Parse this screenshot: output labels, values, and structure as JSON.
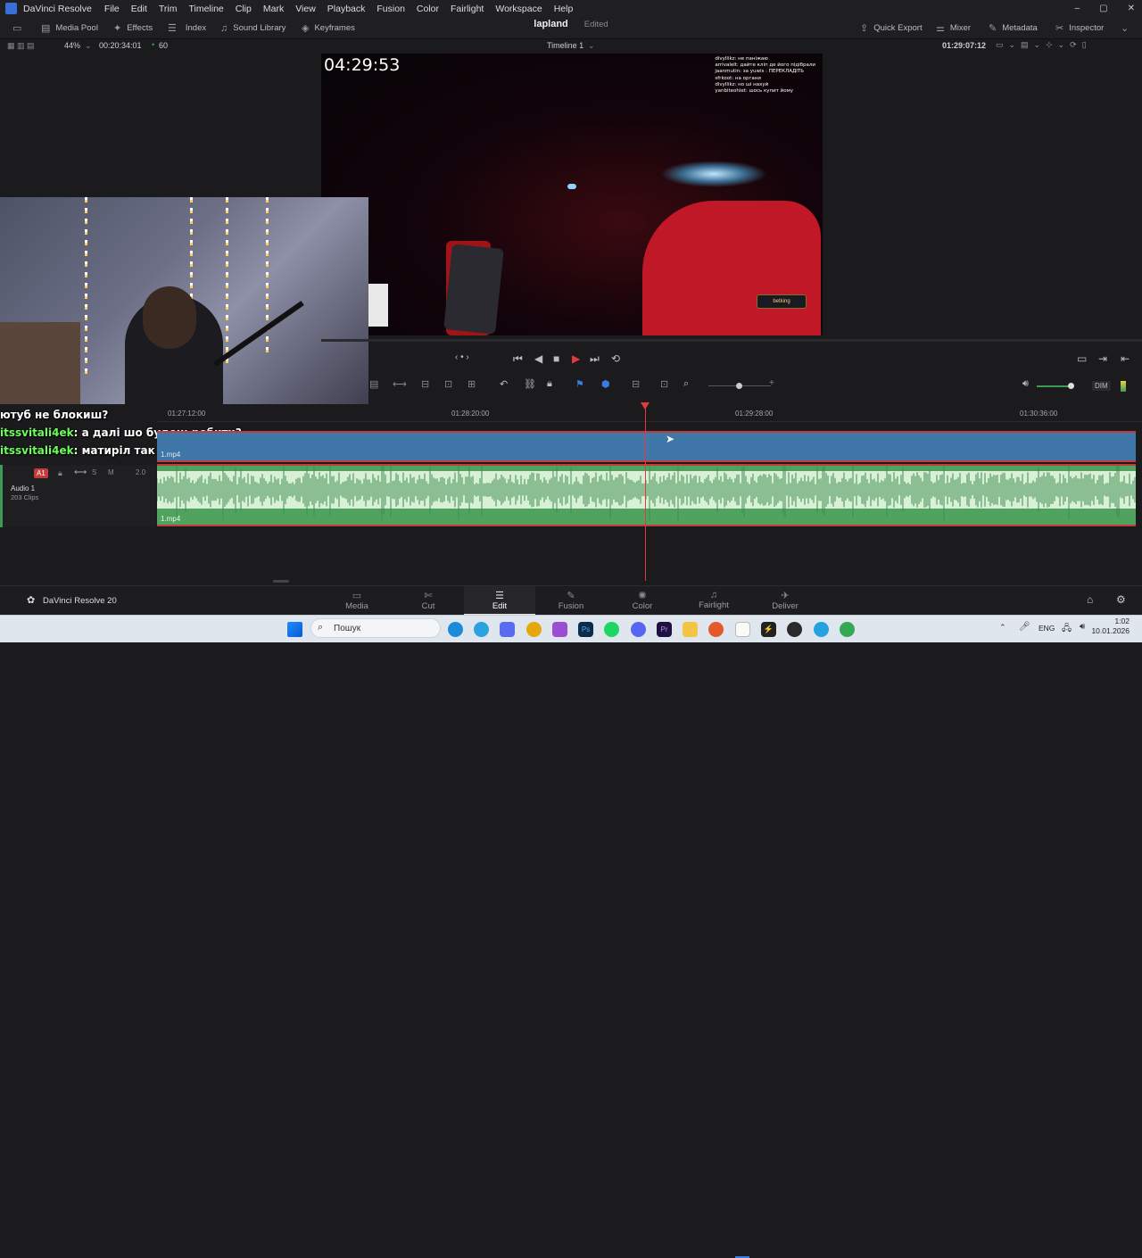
{
  "titlebar": {
    "app": "DaVinci Resolve",
    "menu": [
      "File",
      "Edit",
      "Trim",
      "Timeline",
      "Clip",
      "Mark",
      "View",
      "Playback",
      "Fusion",
      "Color",
      "Fairlight",
      "Workspace",
      "Help"
    ]
  },
  "toolbar": {
    "media_pool": "Media Pool",
    "effects": "Effects",
    "index": "Index",
    "sound_library": "Sound Library",
    "keyframes": "Keyframes",
    "quick_export": "Quick Export",
    "mixer": "Mixer",
    "metadata": "Metadata",
    "inspector": "Inspector"
  },
  "project": {
    "name": "lapland",
    "status": "Edited"
  },
  "subbar": {
    "zoom": "44%",
    "source_tc": "00:20:34:01",
    "fps": "60",
    "timeline_name": "Timeline 1",
    "record_tc": "01:29:07:12"
  },
  "viewer": {
    "stream_time": "04:29:53",
    "overlay_badge": "betking",
    "overlay_chat": [
      "divyllikz: не паніжаю",
      "arrivalelt: дайте кліп де його підібрали",
      "jaanmutin: за yuwis : ПЕРЕКЛАДІТЬ",
      "sfrkoot: на органи",
      "divyllikz: но ші нахуй",
      "yanbiteohiet: шось купит йому"
    ]
  },
  "chat_overlay": [
    {
      "user": "",
      "text": "ютуб не блокиш?"
    },
    {
      "user": "itssvitali4ek",
      "text": "а далі шо будеш робити?"
    },
    {
      "user": "itssvitali4ek",
      "text": "матиріл так погано впливають?"
    }
  ],
  "timeline": {
    "ruler": [
      "01:27:12:00",
      "01:28:20:00",
      "01:29:28:00",
      "01:30:36:00"
    ],
    "video_clip": "1.mp4",
    "audio": {
      "track_id": "A1",
      "name": "Audio 1",
      "clips": "203 Clips",
      "level": "2.0",
      "clip": "1.mp4",
      "solo": "S",
      "mute": "M"
    }
  },
  "transport": {
    "dim": "DIM"
  },
  "pages": [
    {
      "label": "Media",
      "icon": "media-icon"
    },
    {
      "label": "Cut",
      "icon": "cut-icon"
    },
    {
      "label": "Edit",
      "icon": "edit-icon",
      "active": true
    },
    {
      "label": "Fusion",
      "icon": "fusion-icon"
    },
    {
      "label": "Color",
      "icon": "color-icon"
    },
    {
      "label": "Fairlight",
      "icon": "fairlight-icon"
    },
    {
      "label": "Deliver",
      "icon": "deliver-icon"
    }
  ],
  "brand": "DaVinci Resolve 20",
  "taskbar": {
    "search": "Пошук",
    "lang": "ENG",
    "time": "1:02",
    "date": "10.01.2026"
  }
}
